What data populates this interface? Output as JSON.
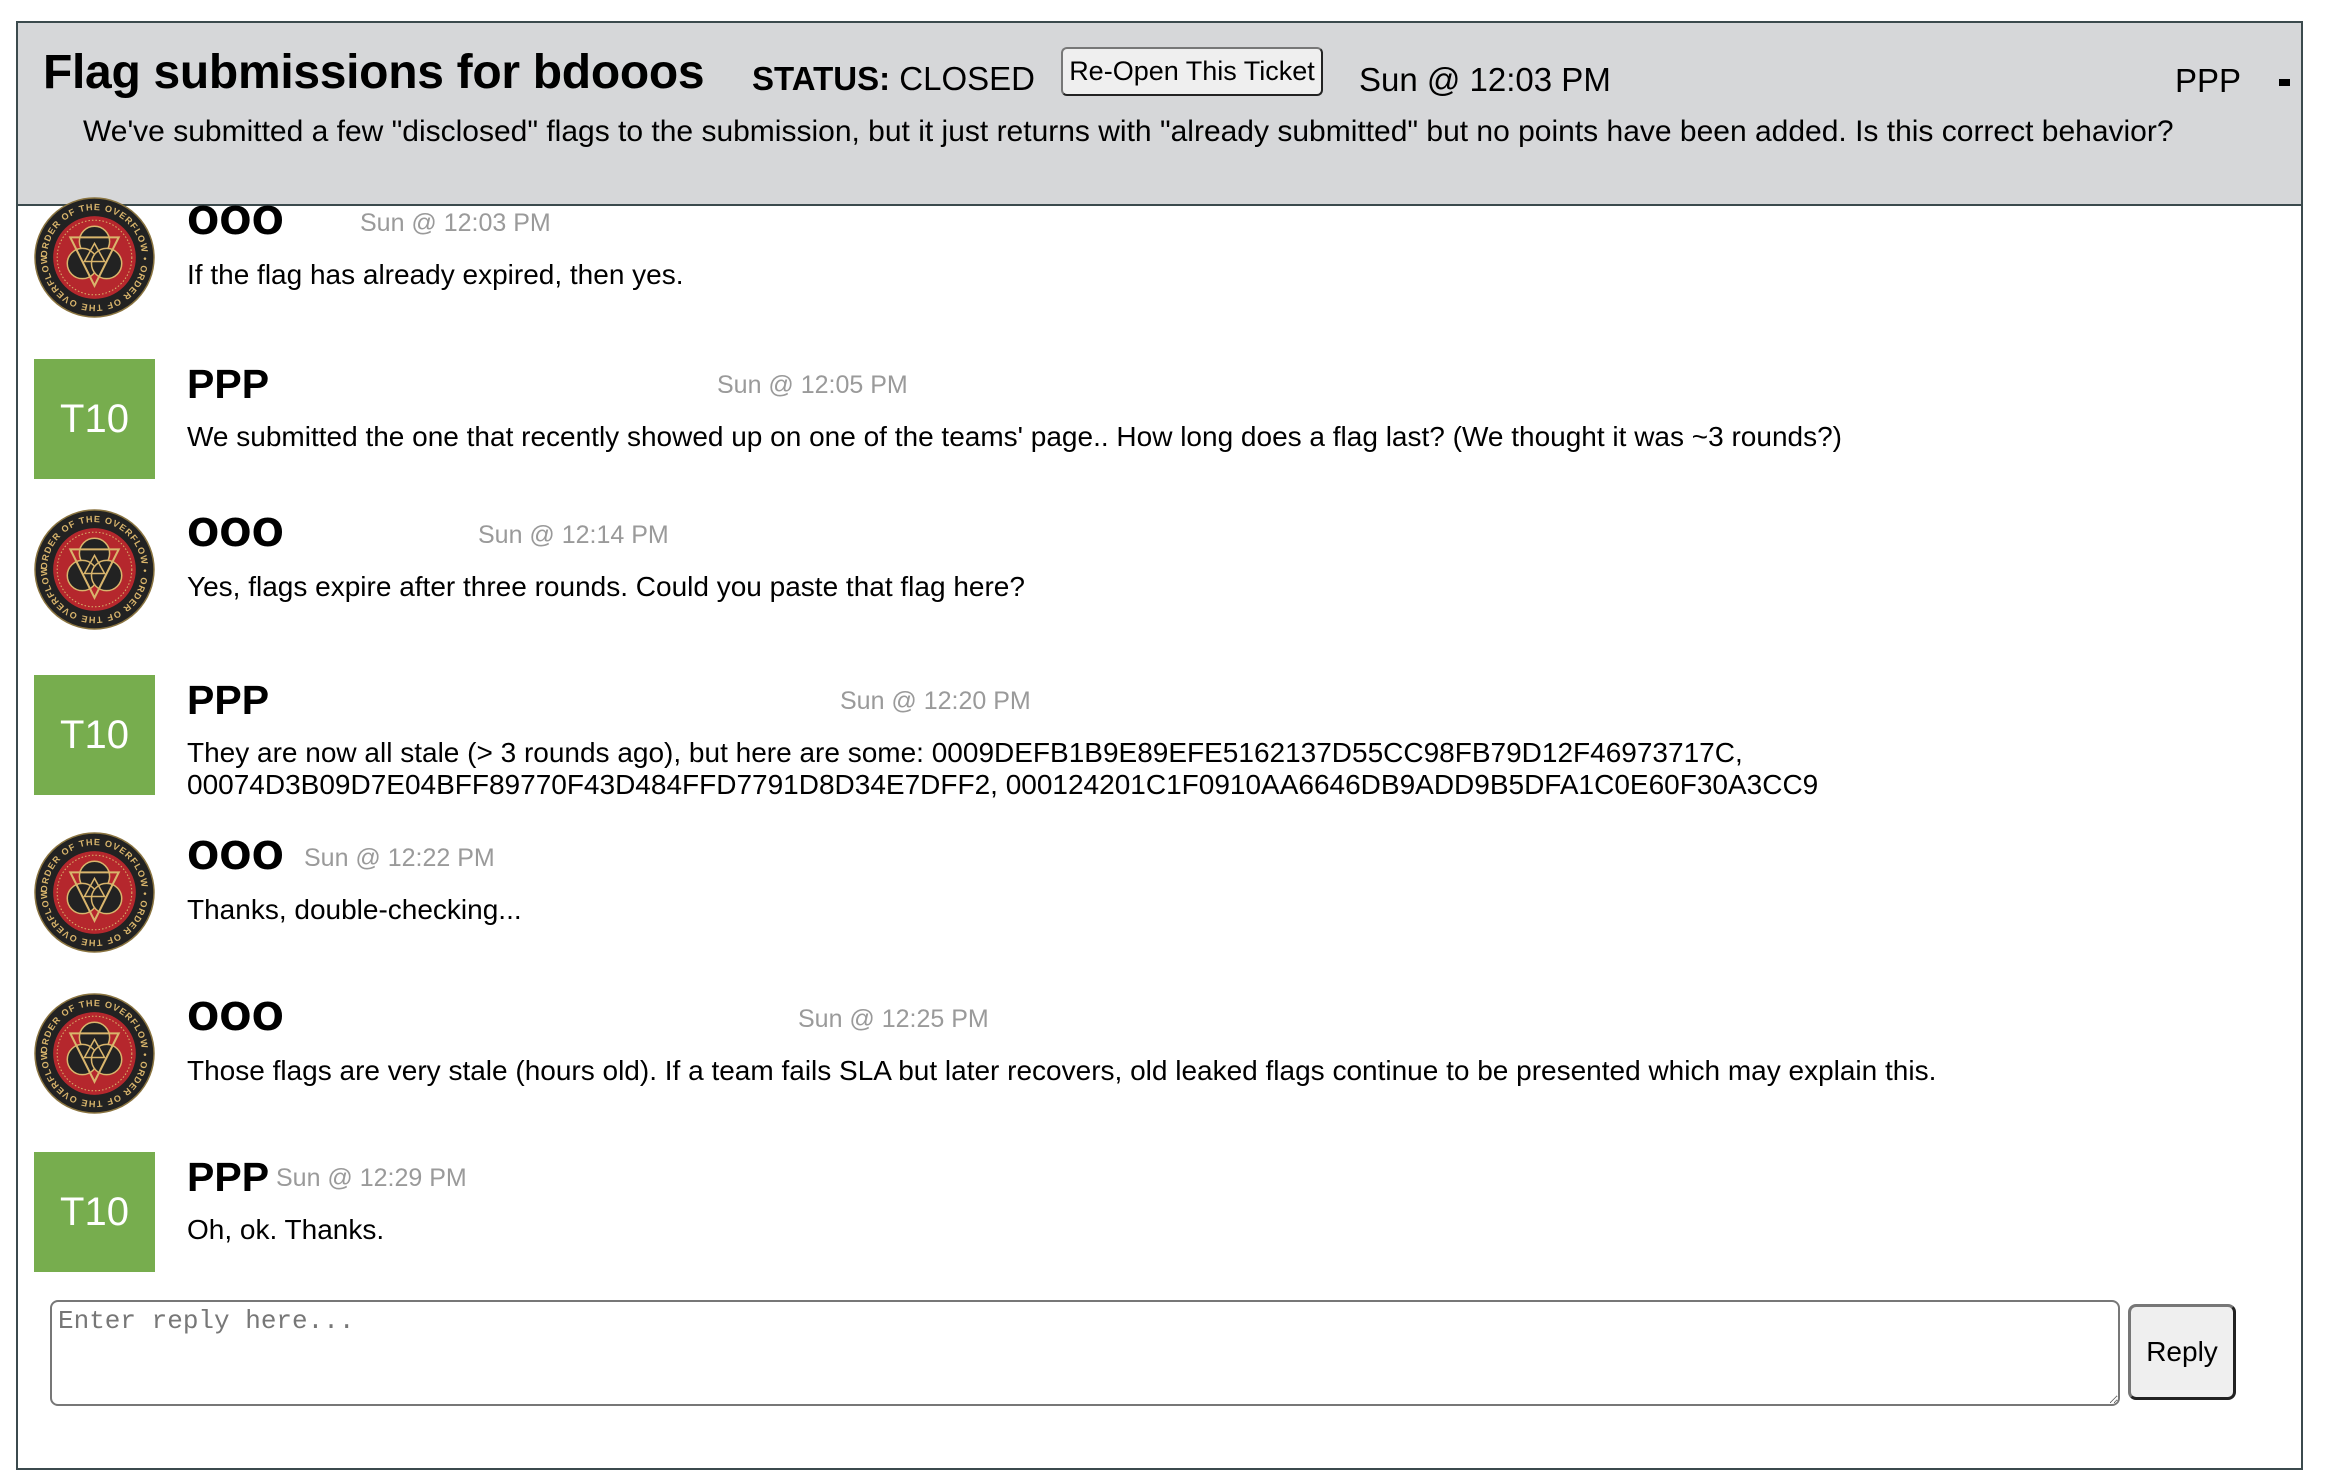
{
  "ticket": {
    "title": "Flag submissions for bdooos",
    "status_label": "STATUS:",
    "status_value": "CLOSED",
    "reopen_label": "Re-Open This Ticket",
    "created": "Sun @ 12:03 PM",
    "owner": "PPP",
    "minimize_icon": "minus-icon",
    "description": "We've submitted a few \"disclosed\" flags to the submission, but it just returns with \"already submitted\" but no points have been added. Is this correct behavior?"
  },
  "messages": [
    {
      "author": "OOO",
      "avatar": "order-of-the-overflow-logo",
      "time": "Sun @ 12:03 PM",
      "text": "If the flag has already expired, then yes."
    },
    {
      "author": "PPP",
      "avatar": "team-badge",
      "avatar_text": "T10",
      "time": "Sun @ 12:05 PM",
      "text": "We submitted the one that recently showed up on one of the teams' page.. How long does a flag last? (We thought it was ~3 rounds?)"
    },
    {
      "author": "OOO",
      "avatar": "order-of-the-overflow-logo",
      "time": "Sun @ 12:14 PM",
      "text": "Yes, flags expire after three rounds. Could you paste that flag here?"
    },
    {
      "author": "PPP",
      "avatar": "team-badge",
      "avatar_text": "T10",
      "time": "Sun @ 12:20 PM",
      "text": "They are now all stale (> 3 rounds ago), but here are some: 0009DEFB1B9E89EFE5162137D55CC98FB79D12F46973717C, 00074D3B09D7E04BFF89770F43D484FFD7791D8D34E7DFF2, 000124201C1F0910AA6646DB9ADD9B5DFA1C0E60F30A3CC9"
    },
    {
      "author": "OOO",
      "avatar": "order-of-the-overflow-logo",
      "time": "Sun @ 12:22 PM",
      "text": "Thanks, double-checking..."
    },
    {
      "author": "OOO",
      "avatar": "order-of-the-overflow-logo",
      "time": "Sun @ 12:25 PM",
      "text": "Those flags are very stale (hours old). If a team fails SLA but later recovers, old leaked flags continue to be presented which may explain this."
    },
    {
      "author": "PPP",
      "avatar": "team-badge",
      "avatar_text": "T10",
      "time": "Sun @ 12:29 PM",
      "text": "Oh, ok. Thanks."
    }
  ],
  "reply": {
    "placeholder": "Enter reply here...",
    "value": "",
    "button_label": "Reply"
  },
  "colors": {
    "header_bg": "#d6d7d9",
    "border": "#3b4a4d",
    "team_badge": "#77ad4e",
    "timestamp": "#9a9a9a",
    "logo_red": "#b5272d",
    "logo_gold": "#c9a15a"
  }
}
